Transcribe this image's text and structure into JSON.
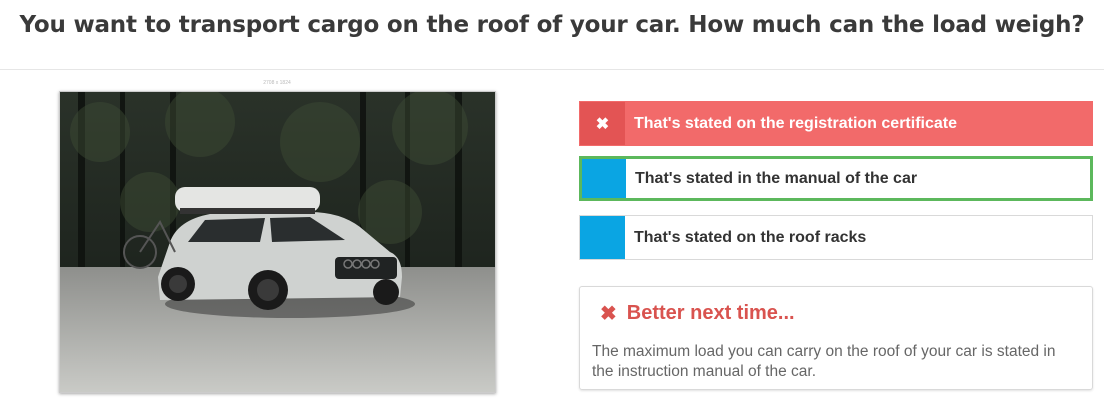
{
  "question": "You want to transport cargo on the roof of your car. How much can the load weigh?",
  "photo": {
    "caption": "2708 x 1824"
  },
  "answers": [
    {
      "label": "That's stated on the registration certificate",
      "state": "wrong",
      "icon": "close-icon"
    },
    {
      "label": "That's stated in the manual of the car",
      "state": "correct"
    },
    {
      "label": "That's stated on the roof racks",
      "state": "neutral"
    }
  ],
  "feedback": {
    "icon": "close-icon",
    "title": "Better next time...",
    "text": "The maximum load you can carry on the roof of your car is stated in the instruction manual of the car."
  },
  "colors": {
    "wrong": "#f26a6a",
    "correct_border": "#5cb85c",
    "neutral_tab": "#0aa5e3",
    "feedback_title": "#d9534f"
  }
}
